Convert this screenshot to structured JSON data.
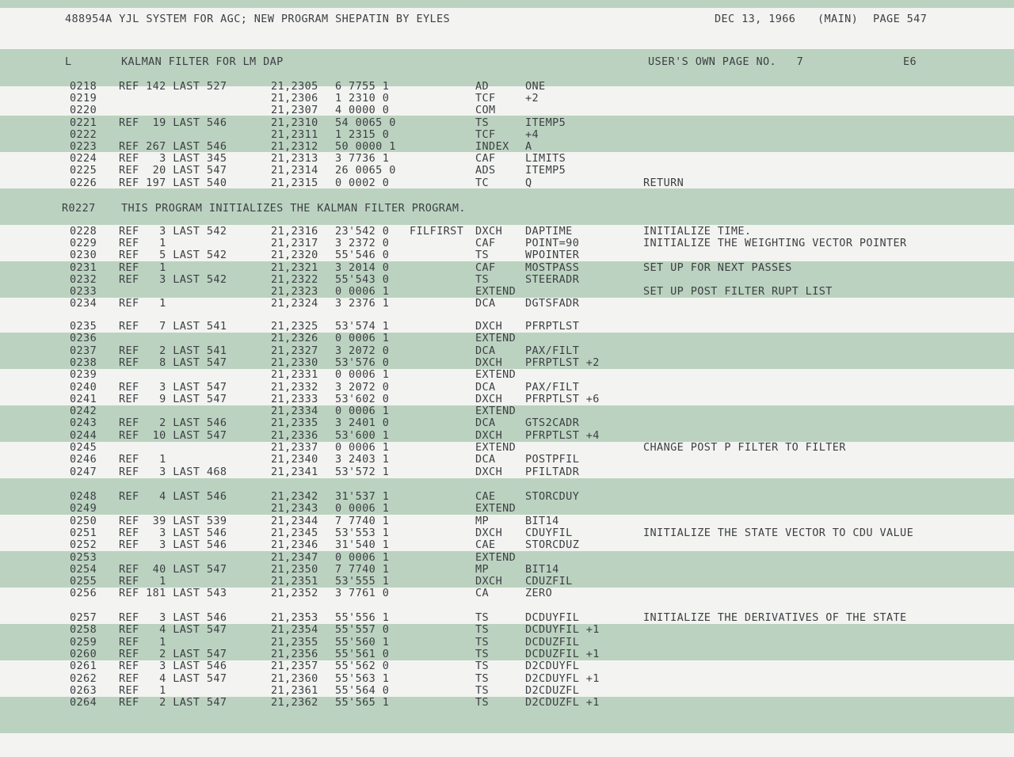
{
  "header": {
    "left": "488954A YJL SYSTEM FOR AGC; NEW PROGRAM SHEPATIN BY EYLES",
    "date": "DEC 13, 1966",
    "section": "(MAIN)",
    "page": "PAGE 547"
  },
  "title_row": {
    "mark": "L",
    "title": "KALMAN FILTER FOR LM DAP",
    "user_page": "USER'S OWN PAGE NO.   7",
    "code": "E6"
  },
  "program_note": {
    "line": "R0227",
    "text": "THIS PROGRAM INITIALIZES THE KALMAN FILTER PROGRAM."
  },
  "rows": [
    {
      "line": "0218",
      "ref": "REF 142 LAST 527",
      "addr": "21,2305",
      "word": "6 7755 1",
      "label": "",
      "op": "AD",
      "operand": "ONE",
      "comment": ""
    },
    {
      "line": "0219",
      "ref": "",
      "addr": "21,2306",
      "word": "1 2310 0",
      "label": "",
      "op": "TCF",
      "operand": "+2",
      "comment": ""
    },
    {
      "line": "0220",
      "ref": "",
      "addr": "21,2307",
      "word": "4 0000 0",
      "label": "",
      "op": "COM",
      "operand": "",
      "comment": ""
    },
    {
      "line": "0221",
      "ref": "REF  19 LAST 546",
      "addr": "21,2310",
      "word": "54 0065 0",
      "label": "",
      "op": "TS",
      "operand": "ITEMP5",
      "comment": ""
    },
    {
      "line": "0222",
      "ref": "",
      "addr": "21,2311",
      "word": "1 2315 0",
      "label": "",
      "op": "TCF",
      "operand": "+4",
      "comment": ""
    },
    {
      "line": "0223",
      "ref": "REF 267 LAST 546",
      "addr": "21,2312",
      "word": "50 0000 1",
      "label": "",
      "op": "INDEX",
      "operand": "A",
      "comment": ""
    },
    {
      "line": "0224",
      "ref": "REF   3 LAST 345",
      "addr": "21,2313",
      "word": "3 7736 1",
      "label": "",
      "op": "CAF",
      "operand": "LIMITS",
      "comment": ""
    },
    {
      "line": "0225",
      "ref": "REF  20 LAST 547",
      "addr": "21,2314",
      "word": "26 0065 0",
      "label": "",
      "op": "ADS",
      "operand": "ITEMP5",
      "comment": ""
    },
    {
      "line": "0226",
      "ref": "REF 197 LAST 540",
      "addr": "21,2315",
      "word": "0 0002 0",
      "label": "",
      "op": "TC",
      "operand": "Q",
      "comment": "RETURN"
    },
    {
      "line": "0228",
      "ref": "REF   3 LAST 542",
      "addr": "21,2316",
      "word": "23'542 0",
      "label": "FILFIRST",
      "op": "DXCH",
      "operand": "DAPTIME",
      "comment": "INITIALIZE TIME."
    },
    {
      "line": "0229",
      "ref": "REF   1",
      "addr": "21,2317",
      "word": "3 2372 0",
      "label": "",
      "op": "CAF",
      "operand": "POINT=90",
      "comment": "INITIALIZE THE WEIGHTING VECTOR POINTER"
    },
    {
      "line": "0230",
      "ref": "REF   5 LAST 542",
      "addr": "21,2320",
      "word": "55'546 0",
      "label": "",
      "op": "TS",
      "operand": "WPOINTER",
      "comment": ""
    },
    {
      "line": "0231",
      "ref": "REF   1",
      "addr": "21,2321",
      "word": "3 2014 0",
      "label": "",
      "op": "CAF",
      "operand": "MOSTPASS",
      "comment": "SET UP FOR NEXT PASSES"
    },
    {
      "line": "0232",
      "ref": "REF   3 LAST 542",
      "addr": "21,2322",
      "word": "55'543 0",
      "label": "",
      "op": "TS",
      "operand": "STEERADR",
      "comment": ""
    },
    {
      "line": "0233",
      "ref": "",
      "addr": "21,2323",
      "word": "0 0006 1",
      "label": "",
      "op": "EXTEND",
      "operand": "",
      "comment": "SET UP POST FILTER RUPT LIST"
    },
    {
      "line": "0234",
      "ref": "REF   1",
      "addr": "21,2324",
      "word": "3 2376 1",
      "label": "",
      "op": "DCA",
      "operand": "DGTSFADR",
      "comment": ""
    },
    {
      "line": "0235",
      "ref": "REF   7 LAST 541",
      "addr": "21,2325",
      "word": "53'574 1",
      "label": "",
      "op": "DXCH",
      "operand": "PFRPTLST",
      "comment": ""
    },
    {
      "line": "0236",
      "ref": "",
      "addr": "21,2326",
      "word": "0 0006 1",
      "label": "",
      "op": "EXTEND",
      "operand": "",
      "comment": ""
    },
    {
      "line": "0237",
      "ref": "REF   2 LAST 541",
      "addr": "21,2327",
      "word": "3 2072 0",
      "label": "",
      "op": "DCA",
      "operand": "PAX/FILT",
      "comment": ""
    },
    {
      "line": "0238",
      "ref": "REF   8 LAST 547",
      "addr": "21,2330",
      "word": "53'576 0",
      "label": "",
      "op": "DXCH",
      "operand": "PFRPTLST +2",
      "comment": ""
    },
    {
      "line": "0239",
      "ref": "",
      "addr": "21,2331",
      "word": "0 0006 1",
      "label": "",
      "op": "EXTEND",
      "operand": "",
      "comment": ""
    },
    {
      "line": "0240",
      "ref": "REF   3 LAST 547",
      "addr": "21,2332",
      "word": "3 2072 0",
      "label": "",
      "op": "DCA",
      "operand": "PAX/FILT",
      "comment": ""
    },
    {
      "line": "0241",
      "ref": "REF   9 LAST 547",
      "addr": "21,2333",
      "word": "53'602 0",
      "label": "",
      "op": "DXCH",
      "operand": "PFRPTLST +6",
      "comment": ""
    },
    {
      "line": "0242",
      "ref": "",
      "addr": "21,2334",
      "word": "0 0006 1",
      "label": "",
      "op": "EXTEND",
      "operand": "",
      "comment": ""
    },
    {
      "line": "0243",
      "ref": "REF   2 LAST 546",
      "addr": "21,2335",
      "word": "3 2401 0",
      "label": "",
      "op": "DCA",
      "operand": "GTS2CADR",
      "comment": ""
    },
    {
      "line": "0244",
      "ref": "REF  10 LAST 547",
      "addr": "21,2336",
      "word": "53'600 1",
      "label": "",
      "op": "DXCH",
      "operand": "PFRPTLST +4",
      "comment": ""
    },
    {
      "line": "0245",
      "ref": "",
      "addr": "21,2337",
      "word": "0 0006 1",
      "label": "",
      "op": "EXTEND",
      "operand": "",
      "comment": "CHANGE POST P FILTER TO FILTER"
    },
    {
      "line": "0246",
      "ref": "REF   1",
      "addr": "21,2340",
      "word": "3 2403 1",
      "label": "",
      "op": "DCA",
      "operand": "POSTPFIL",
      "comment": ""
    },
    {
      "line": "0247",
      "ref": "REF   3 LAST 468",
      "addr": "21,2341",
      "word": "53'572 1",
      "label": "",
      "op": "DXCH",
      "operand": "PFILTADR",
      "comment": ""
    },
    {
      "line": "0248",
      "ref": "REF   4 LAST 546",
      "addr": "21,2342",
      "word": "31'537 1",
      "label": "",
      "op": "CAE",
      "operand": "STORCDUY",
      "comment": ""
    },
    {
      "line": "0249",
      "ref": "",
      "addr": "21,2343",
      "word": "0 0006 1",
      "label": "",
      "op": "EXTEND",
      "operand": "",
      "comment": ""
    },
    {
      "line": "0250",
      "ref": "REF  39 LAST 539",
      "addr": "21,2344",
      "word": "7 7740 1",
      "label": "",
      "op": "MP",
      "operand": "BIT14",
      "comment": ""
    },
    {
      "line": "0251",
      "ref": "REF   3 LAST 546",
      "addr": "21,2345",
      "word": "53'553 1",
      "label": "",
      "op": "DXCH",
      "operand": "CDUYFIL",
      "comment": "INITIALIZE THE STATE VECTOR TO CDU VALUE"
    },
    {
      "line": "0252",
      "ref": "REF   3 LAST 546",
      "addr": "21,2346",
      "word": "31'540 1",
      "label": "",
      "op": "CAE",
      "operand": "STORCDUZ",
      "comment": ""
    },
    {
      "line": "0253",
      "ref": "",
      "addr": "21,2347",
      "word": "0 0006 1",
      "label": "",
      "op": "EXTEND",
      "operand": "",
      "comment": ""
    },
    {
      "line": "0254",
      "ref": "REF  40 LAST 547",
      "addr": "21,2350",
      "word": "7 7740 1",
      "label": "",
      "op": "MP",
      "operand": "BIT14",
      "comment": ""
    },
    {
      "line": "0255",
      "ref": "REF   1",
      "addr": "21,2351",
      "word": "53'555 1",
      "label": "",
      "op": "DXCH",
      "operand": "CDUZFIL",
      "comment": ""
    },
    {
      "line": "0256",
      "ref": "REF 181 LAST 543",
      "addr": "21,2352",
      "word": "3 7761 0",
      "label": "",
      "op": "CA",
      "operand": "ZERO",
      "comment": ""
    },
    {
      "line": "0257",
      "ref": "REF   3 LAST 546",
      "addr": "21,2353",
      "word": "55'556 1",
      "label": "",
      "op": "TS",
      "operand": "DCDUYFIL",
      "comment": "INITIALIZE THE DERIVATIVES OF THE STATE"
    },
    {
      "line": "0258",
      "ref": "REF   4 LAST 547",
      "addr": "21,2354",
      "word": "55'557 0",
      "label": "",
      "op": "TS",
      "operand": "DCDUYFIL +1",
      "comment": ""
    },
    {
      "line": "0259",
      "ref": "REF   1",
      "addr": "21,2355",
      "word": "55'560 1",
      "label": "",
      "op": "TS",
      "operand": "DCDUZFIL",
      "comment": ""
    },
    {
      "line": "0260",
      "ref": "REF   2 LAST 547",
      "addr": "21,2356",
      "word": "55'561 0",
      "label": "",
      "op": "TS",
      "operand": "DCDUZFIL +1",
      "comment": ""
    },
    {
      "line": "0261",
      "ref": "REF   3 LAST 546",
      "addr": "21,2357",
      "word": "55'562 0",
      "label": "",
      "op": "TS",
      "operand": "D2CDUYFL",
      "comment": ""
    },
    {
      "line": "0262",
      "ref": "REF   4 LAST 547",
      "addr": "21,2360",
      "word": "55'563 1",
      "label": "",
      "op": "TS",
      "operand": "D2CDUYFL +1",
      "comment": ""
    },
    {
      "line": "0263",
      "ref": "REF   1",
      "addr": "21,2361",
      "word": "55'564 0",
      "label": "",
      "op": "TS",
      "operand": "D2CDUZFL",
      "comment": ""
    },
    {
      "line": "0264",
      "ref": "REF   2 LAST 547",
      "addr": "21,2362",
      "word": "55'565 1",
      "label": "",
      "op": "TS",
      "operand": "D2CDUZFL +1",
      "comment": ""
    }
  ]
}
